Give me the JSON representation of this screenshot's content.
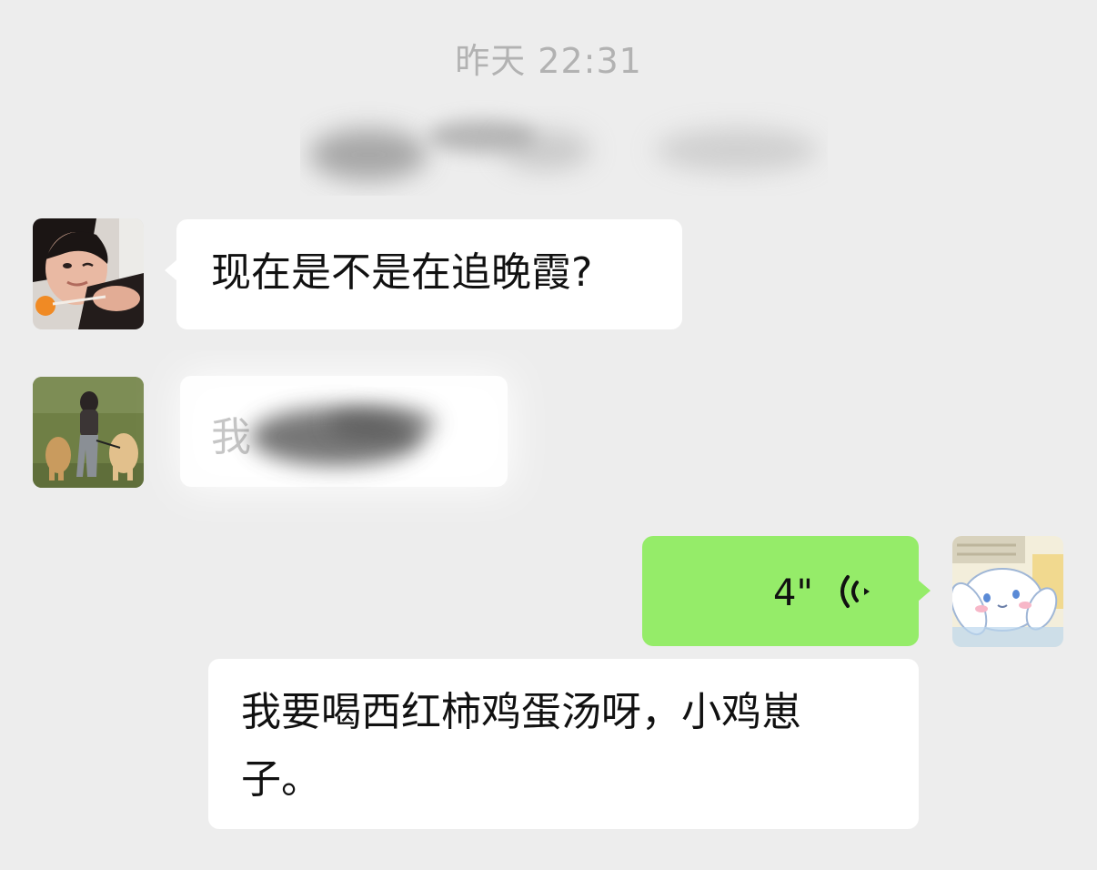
{
  "chat": {
    "timestamp": "昨天 22:31",
    "messages": [
      {
        "side": "left",
        "type": "text",
        "avatar_icon": "girl-lollipop-avatar",
        "text": "现在是不是在追晚霞?"
      },
      {
        "side": "left",
        "type": "text-redacted",
        "avatar_icon": "girl-walking-dogs-avatar",
        "text": "我"
      },
      {
        "side": "right",
        "type": "voice",
        "avatar_icon": "cinnamoroll-avatar",
        "duration": "4\""
      },
      {
        "side": "right",
        "type": "text",
        "text": "我要喝西红柿鸡蛋汤呀，小鸡崽\n子。"
      }
    ]
  },
  "colors": {
    "background": "#ededed",
    "bubble_incoming": "#ffffff",
    "bubble_outgoing": "#95ec69",
    "timestamp": "#b2b2b2"
  }
}
